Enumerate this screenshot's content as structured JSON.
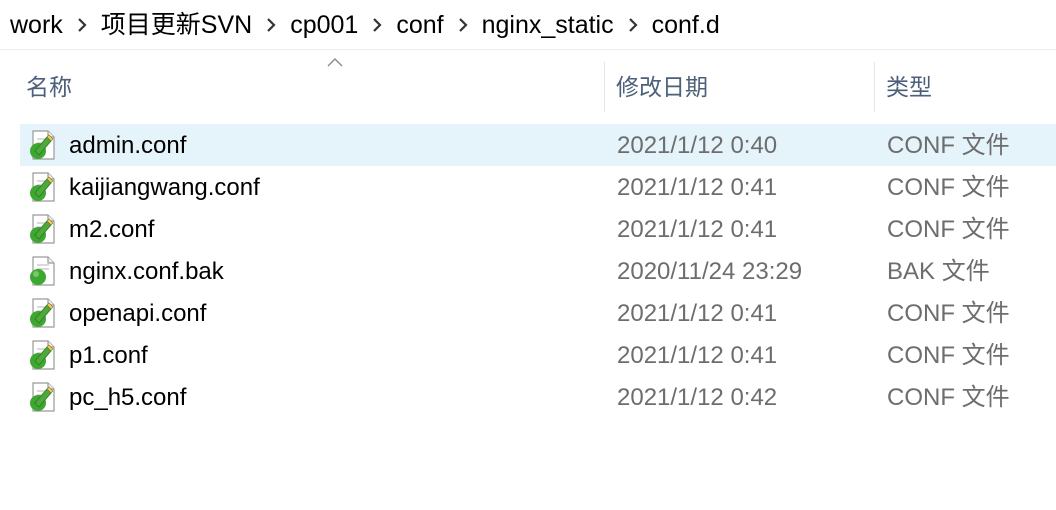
{
  "breadcrumb": {
    "items": [
      {
        "label": "work"
      },
      {
        "label": "项目更新SVN"
      },
      {
        "label": "cp001"
      },
      {
        "label": "conf"
      },
      {
        "label": "nginx_static"
      },
      {
        "label": "conf.d"
      }
    ],
    "separator_icon": "chevron-right-icon"
  },
  "columns": {
    "name": "名称",
    "date": "修改日期",
    "type": "类型",
    "sort_indicator": "sort-ascending-icon"
  },
  "files": [
    {
      "name": "admin.conf",
      "date": "2021/1/12 0:40",
      "type": "CONF 文件",
      "icon": "svn-modified-file-icon",
      "selected": true
    },
    {
      "name": "kaijiangwang.conf",
      "date": "2021/1/12 0:41",
      "type": "CONF 文件",
      "icon": "svn-modified-file-icon",
      "selected": false
    },
    {
      "name": "m2.conf",
      "date": "2021/1/12 0:41",
      "type": "CONF 文件",
      "icon": "svn-modified-file-icon",
      "selected": false
    },
    {
      "name": "nginx.conf.bak",
      "date": "2020/11/24 23:29",
      "type": "BAK 文件",
      "icon": "svn-normal-file-icon",
      "selected": false
    },
    {
      "name": "openapi.conf",
      "date": "2021/1/12 0:41",
      "type": "CONF 文件",
      "icon": "svn-modified-file-icon",
      "selected": false
    },
    {
      "name": "p1.conf",
      "date": "2021/1/12 0:41",
      "type": "CONF 文件",
      "icon": "svn-modified-file-icon",
      "selected": false
    },
    {
      "name": "pc_h5.conf",
      "date": "2021/1/12 0:42",
      "type": "CONF 文件",
      "icon": "svn-modified-file-icon",
      "selected": false
    }
  ],
  "colors": {
    "selection": "#e5f3fb",
    "header_text": "#4c607a",
    "secondary_text": "#6d6d6d",
    "svn_green": "#3da82f"
  }
}
